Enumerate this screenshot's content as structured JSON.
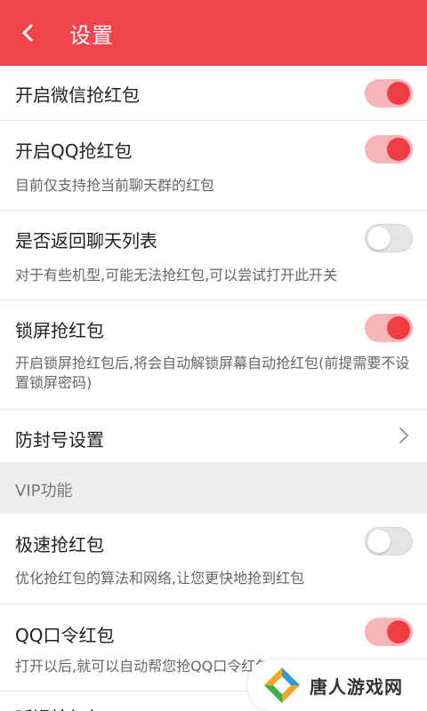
{
  "header": {
    "title": "设置",
    "back_icon": "chevron-left-icon",
    "color": "#f0464b"
  },
  "settings": {
    "wechat": {
      "title": "开启微信抢红包",
      "enabled": true
    },
    "qq": {
      "title": "开启QQ抢红包",
      "desc": "目前仅支持抢当前聊天群的红包",
      "enabled": true
    },
    "back_to_list": {
      "title": "是否返回聊天列表",
      "desc": "对于有些机型,可能无法抢红包,可以尝试打开此开关",
      "enabled": false
    },
    "lock_screen": {
      "title": "锁屏抢红包",
      "desc": "开启锁屏抢红包后,将会自动解锁屏幕自动抢红包(前提需要不设置锁屏密码)",
      "enabled": true
    },
    "anti_ban": {
      "title": "防封号设置",
      "icon": "chevron-right-icon"
    }
  },
  "vip": {
    "section_title": "VIP功能",
    "fast": {
      "title": "极速抢红包",
      "desc": "优化抢红包的算法和网络,让您更快地抢到红包",
      "enabled": false
    },
    "qq_password": {
      "title": "QQ口令红包",
      "desc": "打开以后,就可以自动帮您抢QQ口令红包",
      "enabled": true
    },
    "next_partial": {
      "title": "延迟抢红包"
    }
  },
  "watermark": {
    "text": "唐人游戏网"
  }
}
